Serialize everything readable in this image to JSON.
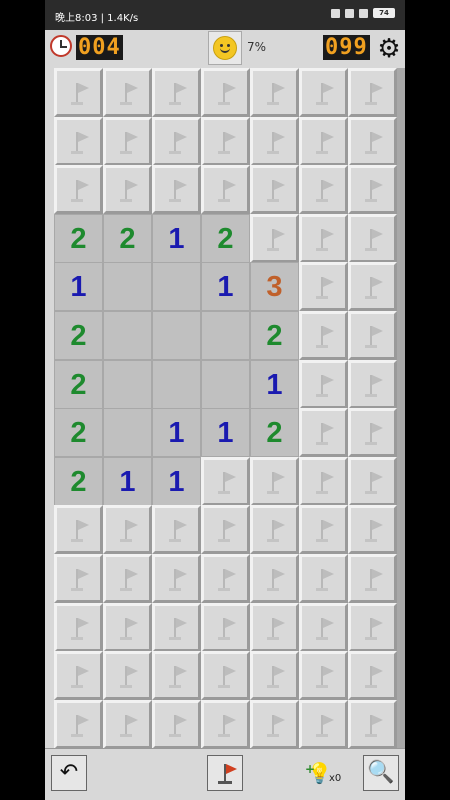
{
  "status_bar": {
    "time": "晚上8:03 | 1.4K/s",
    "battery": "74"
  },
  "header": {
    "timer": "004",
    "progress": "7%",
    "mines_left": "099",
    "icons": {
      "timer": "clock-icon",
      "face": "smiley-face-icon",
      "settings": "gear-icon"
    }
  },
  "board": {
    "columns": 7,
    "rows": 14,
    "cells": [
      "CCCCCCC",
      "CCCCCCC",
      "CCCCCCC",
      "2212CCC",
      "1  13CC",
      "2   2CC",
      "2   1CC",
      "2 112CC",
      "211CCCC",
      "CCCCCCC",
      "CCCCCCC",
      "CCCCCCC",
      "CCCCCCC",
      "CCCCCCC"
    ],
    "number_colors": {
      "1": "#1a1ab0",
      "2": "#1e8a2e",
      "3": "#c0602a"
    }
  },
  "toolbar": {
    "undo_icon": "undo-arrow-icon",
    "flag_mode_icon": "flag-icon",
    "hint_icon": "lightbulb-hint-icon",
    "hint_count": "x0",
    "zoom_icon": "magnifier-icon"
  }
}
